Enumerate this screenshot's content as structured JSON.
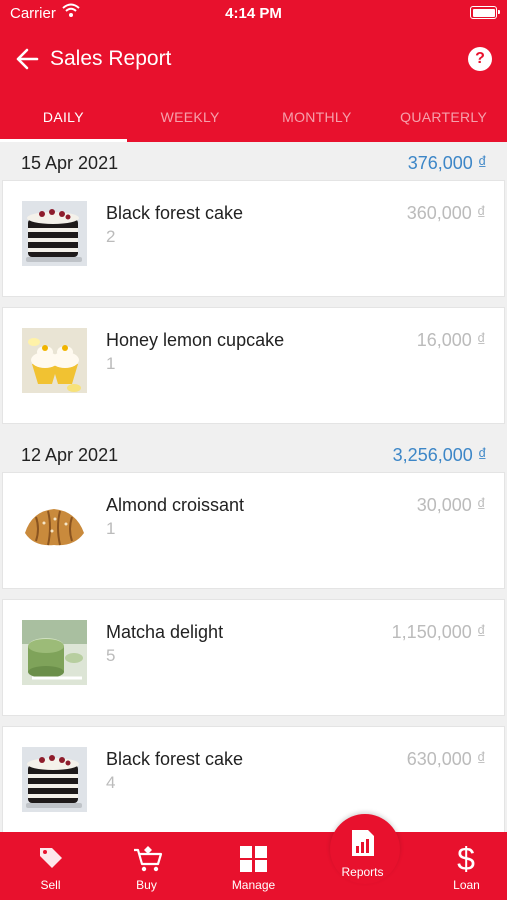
{
  "status_bar": {
    "carrier": "Carrier",
    "time": "4:14 PM"
  },
  "app_bar": {
    "title": "Sales Report"
  },
  "tabs": [
    {
      "label": "DAILY",
      "active": true
    },
    {
      "label": "WEEKLY",
      "active": false
    },
    {
      "label": "MONTHLY",
      "active": false
    },
    {
      "label": "QUARTERLY",
      "active": false
    }
  ],
  "groups": [
    {
      "date": "15 Apr 2021",
      "total": "376,000 ₫",
      "items": [
        {
          "name": "Black forest cake",
          "qty": "2",
          "price": "360,000 ₫",
          "image": "black-forest-cake-image"
        },
        {
          "name": "Honey lemon cupcake",
          "qty": "1",
          "price": "16,000 ₫",
          "image": "cupcake-image"
        }
      ]
    },
    {
      "date": "12 Apr 2021",
      "total": "3,256,000 ₫",
      "items": [
        {
          "name": "Almond croissant",
          "qty": "1",
          "price": "30,000 ₫",
          "image": "croissant-image"
        },
        {
          "name": "Matcha delight",
          "qty": "5",
          "price": "1,150,000 ₫",
          "image": "matcha-image"
        },
        {
          "name": "Black forest cake",
          "qty": "4",
          "price": "630,000 ₫",
          "image": "black-forest-cake-image"
        }
      ]
    }
  ],
  "bottom_nav": [
    {
      "label": "Sell",
      "icon": "tag-icon"
    },
    {
      "label": "Buy",
      "icon": "cart-icon"
    },
    {
      "label": "Manage",
      "icon": "grid-icon"
    },
    {
      "label": "Reports",
      "icon": "report-icon",
      "active": true
    },
    {
      "label": "Loan",
      "icon": "dollar-icon"
    }
  ],
  "colors": {
    "primary": "#e8112d",
    "accent_blue": "#3c86c7",
    "muted": "#bbbbbb"
  }
}
